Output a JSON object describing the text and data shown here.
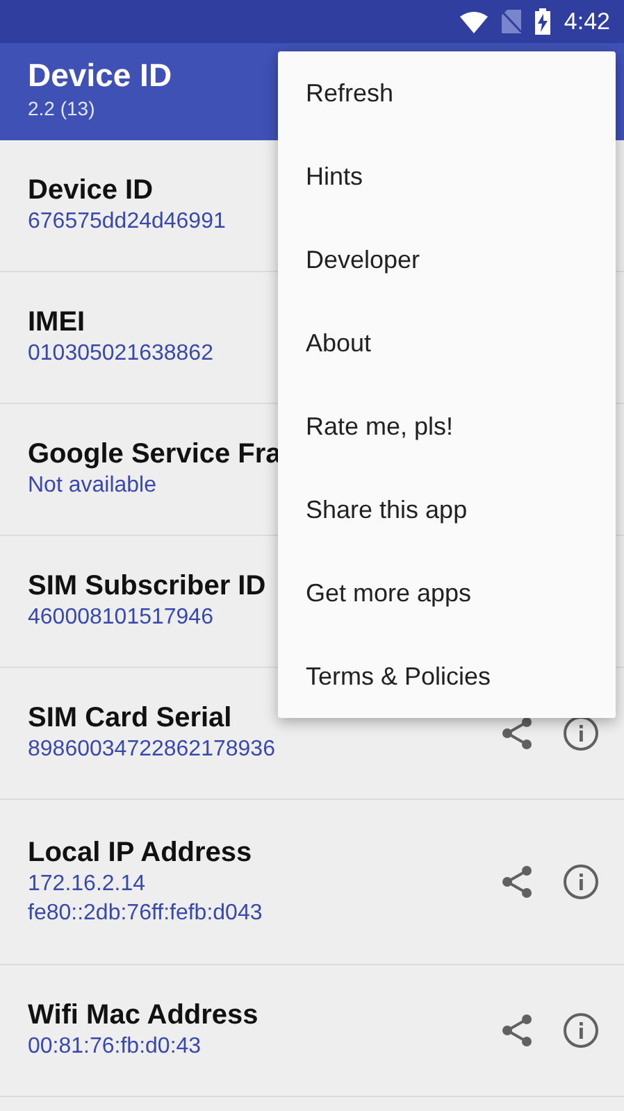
{
  "status_bar": {
    "time": "4:42"
  },
  "app_bar": {
    "title": "Device ID",
    "subtitle": "2.2 (13)"
  },
  "rows": [
    {
      "title": "Device ID",
      "values": [
        "676575dd24d46991"
      ]
    },
    {
      "title": "IMEI",
      "values": [
        "010305021638862"
      ]
    },
    {
      "title": "Google Service Fra",
      "values": [
        "Not available"
      ]
    },
    {
      "title": "SIM Subscriber ID",
      "values": [
        "460008101517946"
      ]
    },
    {
      "title": "SIM Card Serial",
      "values": [
        "89860034722862178936"
      ]
    },
    {
      "title": "Local IP Address",
      "values": [
        "172.16.2.14",
        "fe80::2db:76ff:fefb:d043"
      ]
    },
    {
      "title": "Wifi Mac Address",
      "values": [
        "00:81:76:fb:d0:43"
      ]
    }
  ],
  "menu": {
    "items": [
      "Refresh",
      "Hints",
      "Developer",
      "About",
      "Rate me, pls!",
      "Share this app",
      "Get more apps",
      "Terms & Policies"
    ]
  }
}
